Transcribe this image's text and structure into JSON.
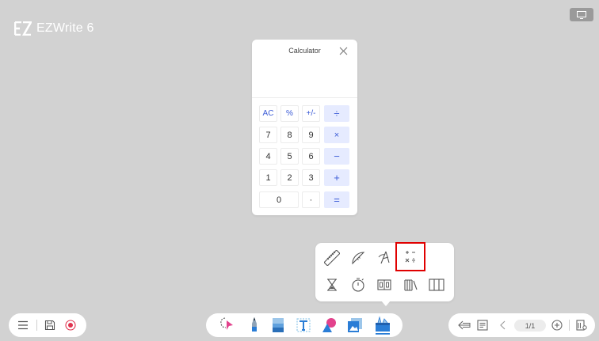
{
  "app": {
    "logo_text": "EZWrite 6"
  },
  "calculator": {
    "title": "Calculator",
    "display": "",
    "keys": {
      "ac": "AC",
      "percent": "%",
      "plusminus": "+/-",
      "divide": "÷",
      "seven": "7",
      "eight": "8",
      "nine": "9",
      "multiply": "×",
      "four": "4",
      "five": "5",
      "six": "6",
      "minus": "−",
      "one": "1",
      "two": "2",
      "three": "3",
      "plus": "+",
      "zero": "0",
      "dot": "·",
      "equals": "="
    }
  },
  "tools_popup": {
    "row1": [
      "ruler-icon",
      "protractor-icon",
      "compass-icon",
      "calculator-icon"
    ],
    "row2": [
      "hourglass-icon",
      "stopwatch-icon",
      "scoreboard-icon",
      "books-icon",
      "columns-icon"
    ],
    "selected": "calculator-icon"
  },
  "pager": {
    "page": "1/1"
  },
  "colors": {
    "accent": "#3b5bd6",
    "record": "#e0334f",
    "highlight": "#e00000",
    "background": "#d2d2d2"
  }
}
